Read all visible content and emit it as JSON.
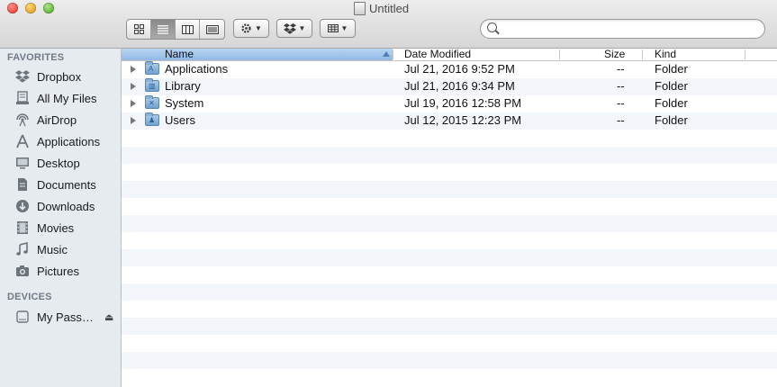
{
  "window": {
    "title": "Untitled"
  },
  "toolbar": {
    "view_buttons": [
      "icon-view",
      "list-view",
      "column-view",
      "cover-flow-view"
    ],
    "active_view": "list-view",
    "action_menu": "gear-icon",
    "dropbox_menu": "dropbox-icon",
    "arrange_menu": "grid-icon",
    "search": {
      "value": "",
      "placeholder": ""
    }
  },
  "sidebar": {
    "favorites_header": "FAVORITES",
    "favorites": [
      {
        "label": "Dropbox",
        "icon": "dropbox-icon"
      },
      {
        "label": "All My Files",
        "icon": "all-files-icon"
      },
      {
        "label": "AirDrop",
        "icon": "airdrop-icon"
      },
      {
        "label": "Applications",
        "icon": "applications-icon"
      },
      {
        "label": "Desktop",
        "icon": "desktop-icon"
      },
      {
        "label": "Documents",
        "icon": "documents-icon"
      },
      {
        "label": "Downloads",
        "icon": "downloads-icon"
      },
      {
        "label": "Movies",
        "icon": "movies-icon"
      },
      {
        "label": "Music",
        "icon": "music-icon"
      },
      {
        "label": "Pictures",
        "icon": "pictures-icon"
      }
    ],
    "devices_header": "DEVICES",
    "devices": [
      {
        "label": "My Pass…",
        "icon": "drive-icon"
      }
    ]
  },
  "list": {
    "columns": {
      "name": "Name",
      "date": "Date Modified",
      "size": "Size",
      "kind": "Kind"
    },
    "sorted_by": "name",
    "rows": [
      {
        "name": "Applications",
        "date": "Jul 21, 2016 9:52 PM",
        "size": "--",
        "kind": "Folder"
      },
      {
        "name": "Library",
        "date": "Jul 21, 2016 9:34 PM",
        "size": "--",
        "kind": "Folder"
      },
      {
        "name": "System",
        "date": "Jul 19, 2016 12:58 PM",
        "size": "--",
        "kind": "Folder"
      },
      {
        "name": "Users",
        "date": "Jul 12, 2015 12:23 PM",
        "size": "--",
        "kind": "Folder"
      }
    ]
  }
}
